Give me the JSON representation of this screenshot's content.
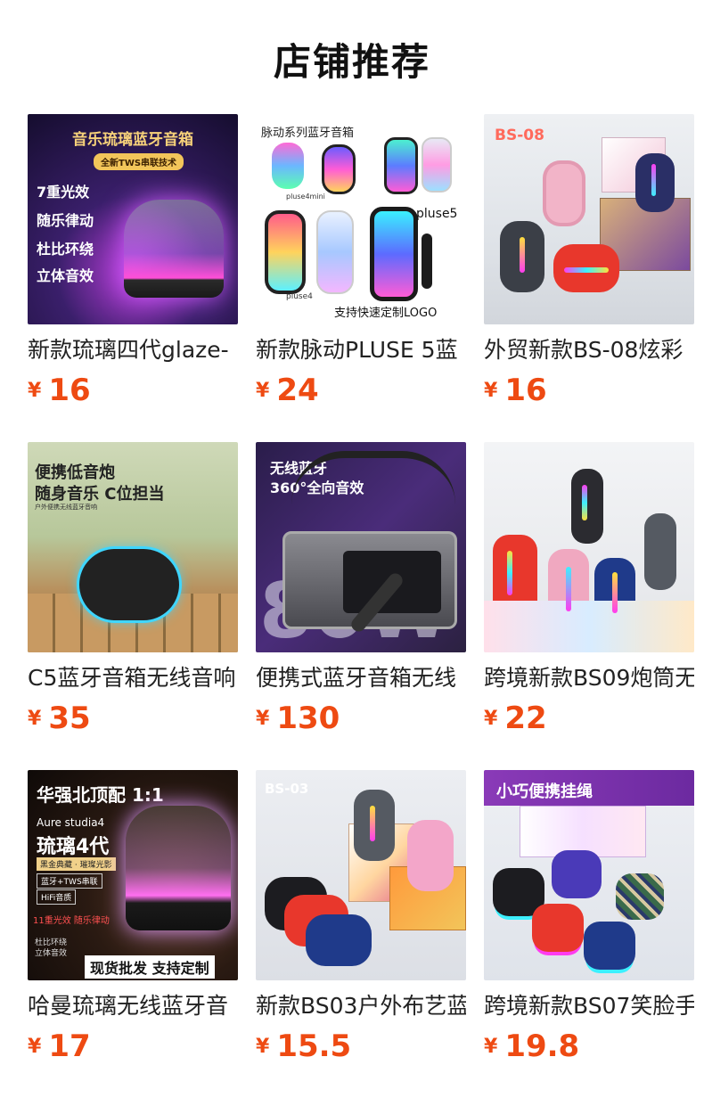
{
  "page": {
    "title": "店铺推荐"
  },
  "products": [
    {
      "name": "新款琉璃四代glaze-",
      "currency": "¥",
      "price": "16",
      "image_text": [
        "音乐琉璃蓝牙音箱",
        "全新TWS串联技术",
        "7重光效",
        "随乐律动",
        "杜比环绕",
        "立体音效"
      ]
    },
    {
      "name": "新款脉动PLUSE 5蓝",
      "currency": "¥",
      "price": "24",
      "image_text": [
        "脉动系列蓝牙音箱",
        "pluse4mini",
        "pluse5",
        "pluse4",
        "支持快速定制LOGO"
      ]
    },
    {
      "name": "外贸新款BS-08炫彩",
      "currency": "¥",
      "price": "16",
      "image_text": [
        "BS-08"
      ]
    },
    {
      "name": "C5蓝牙音箱无线音响",
      "currency": "¥",
      "price": "35",
      "image_text": [
        "便携低音炮",
        "随身音乐 C位担当",
        "户外便携无线蓝牙音响"
      ]
    },
    {
      "name": "便携式蓝牙音箱无线",
      "currency": "¥",
      "price": "130",
      "image_text": [
        "无线蓝牙",
        "360°全向音效",
        "80W"
      ]
    },
    {
      "name": "跨境新款BS09炮筒无",
      "currency": "¥",
      "price": "22",
      "image_text": []
    },
    {
      "name": "哈曼琉璃无线蓝牙音",
      "currency": "¥",
      "price": "17",
      "image_text": [
        "华强北顶配 1:1",
        "Aure studia4",
        "琉璃4代",
        "黑金典藏 · 璀璨光影",
        "蓝牙+TWS串联",
        "HiFi音质",
        "11重光效 随乐律动",
        "杜比环绕",
        "立体音效",
        "现货批发  支持定制"
      ]
    },
    {
      "name": "新款BS03户外布艺蓝",
      "currency": "¥",
      "price": "15.5",
      "image_text": [
        "BS-03"
      ]
    },
    {
      "name": "跨境新款BS07笑脸手",
      "currency": "¥",
      "price": "19.8",
      "image_text": [
        "小巧便携挂绳"
      ]
    }
  ]
}
